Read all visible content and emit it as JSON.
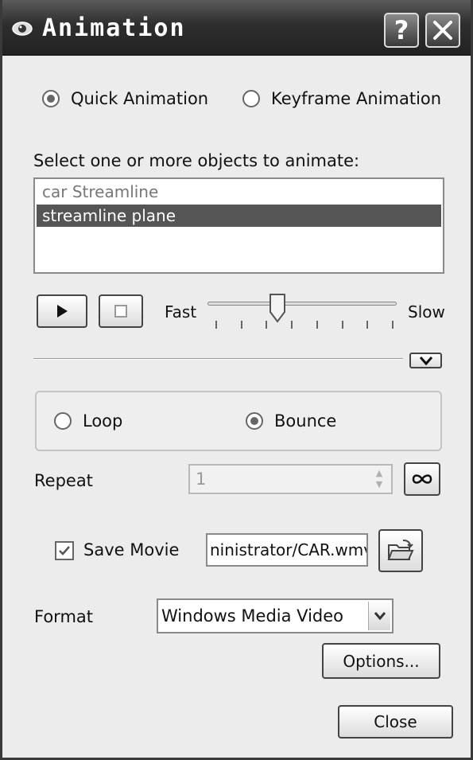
{
  "window": {
    "title": "Animation",
    "help_button": "?",
    "close_button": "✕",
    "icon": "eye-icon"
  },
  "mode": {
    "options": [
      "Quick Animation",
      "Keyframe Animation"
    ],
    "selected": "Quick Animation"
  },
  "objects": {
    "label": "Select one or more objects to animate:",
    "items": [
      {
        "label": "car Streamline",
        "selected": false
      },
      {
        "label": "streamline plane",
        "selected": true
      }
    ]
  },
  "playback": {
    "play_icon": "play-icon",
    "stop_icon": "stop-icon",
    "speed_min_label": "Fast",
    "speed_max_label": "Slow",
    "speed_level": 0.35,
    "tick_count": 8
  },
  "expand_icon": "chevron-down-icon",
  "loop_mode": {
    "options": [
      "Loop",
      "Bounce"
    ],
    "selected": "Bounce"
  },
  "repeat": {
    "label": "Repeat",
    "value": "1",
    "infinite_icon": "infinity-icon"
  },
  "save_movie": {
    "label": "Save Movie",
    "checked": true,
    "path": "ninistrator/CAR.wmv",
    "browse_icon": "open-folder-icon"
  },
  "format": {
    "label": "Format",
    "selected": "Windows Media Video",
    "options_button": "Options..."
  },
  "footer": {
    "close_button": "Close"
  },
  "colors": {
    "titlebar": "#2e2e2e",
    "selection": "#555555",
    "window_bg": "#ececec"
  }
}
